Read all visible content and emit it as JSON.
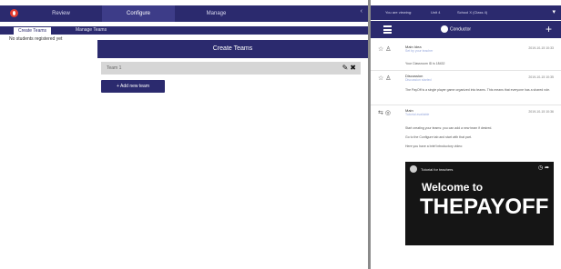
{
  "main_tabs": [
    {
      "label": "Review"
    },
    {
      "label": "Configure"
    },
    {
      "label": "Manage"
    }
  ],
  "collapse_glyph": "‹",
  "sub_tabs": [
    {
      "label": "Create Teams"
    },
    {
      "label": "Manage Teams"
    }
  ],
  "empty_message": "No students registered yet",
  "create_panel": {
    "title": "Create Teams",
    "team_name": "Team 1",
    "add_button": "+ Add new team"
  },
  "right_top": {
    "label": "You are viewing:",
    "class_label": "Unit 4",
    "school_label": "School X (Class 4)"
  },
  "right_bar": {
    "brand": "Conductor"
  },
  "feed": [
    {
      "name": "Main Idea",
      "sub": "Set by your teacher",
      "date": "2019-10-15 10:33",
      "text": "Your Classroom ID is 18432"
    },
    {
      "name": "Discussion",
      "sub": "Discussion started",
      "date": "2019-10-15 10:35",
      "text": "The PayOff is a single player game organized into teams. This means that everyone has a shared role."
    },
    {
      "name": "Main",
      "sub": "Tutorial available",
      "date": "2019-10-15 10:36",
      "lines": [
        "Start creating your teams: you can add a new team if desired.",
        "Go to the Configure tab and start with that part.",
        "Here you have a brief introductory video:"
      ]
    }
  ],
  "video": {
    "title": "Tutorial for teachers",
    "welcome": "Welcome to",
    "brand": "THEPAYOFF"
  },
  "colors": {
    "navy": "#2b2a6e",
    "active_tab": "#3d3c88",
    "logo_red": "#e43c2f",
    "team_row": "#d6d6d6",
    "divider": "#8a8a8a"
  },
  "icons": {
    "edit": "pencil-icon",
    "delete": "close-icon",
    "menu": "hamburger-icon",
    "add": "plus-icon",
    "chevron": "chevron-down-icon",
    "star": "star-icon",
    "user": "user-icon"
  }
}
